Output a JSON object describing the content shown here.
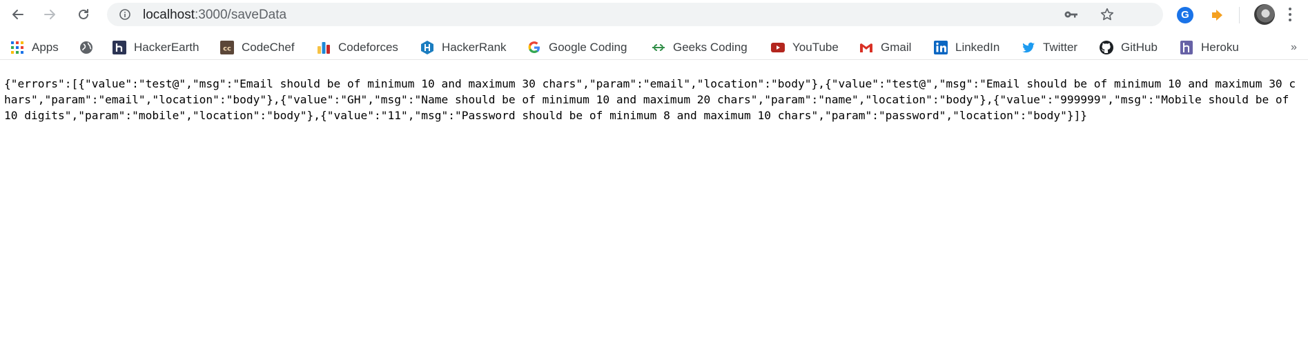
{
  "browser": {
    "url_host": "localhost",
    "url_path": ":3000/saveData"
  },
  "bookmarks": [
    {
      "label": "Apps",
      "icon": "apps-grid-icon"
    },
    {
      "label": "",
      "icon": "globe-icon"
    },
    {
      "label": "HackerEarth",
      "icon": "hackerearth-icon"
    },
    {
      "label": "CodeChef",
      "icon": "codechef-icon"
    },
    {
      "label": "Codeforces",
      "icon": "codeforces-icon"
    },
    {
      "label": "HackerRank",
      "icon": "hackerrank-icon"
    },
    {
      "label": "Google Coding",
      "icon": "google-icon"
    },
    {
      "label": "Geeks Coding",
      "icon": "geeksforgeeks-icon"
    },
    {
      "label": "YouTube",
      "icon": "youtube-icon"
    },
    {
      "label": "Gmail",
      "icon": "gmail-icon"
    },
    {
      "label": "LinkedIn",
      "icon": "linkedin-icon"
    },
    {
      "label": "Twitter",
      "icon": "twitter-icon"
    },
    {
      "label": "GitHub",
      "icon": "github-icon"
    },
    {
      "label": "Heroku",
      "icon": "heroku-icon"
    }
  ],
  "page": {
    "body_text": "{\"errors\":[{\"value\":\"test@\",\"msg\":\"Email should be of minimum 10 and maximum 30 chars\",\"param\":\"email\",\"location\":\"body\"},{\"value\":\"test@\",\"msg\":\"Email should be of minimum 10 and maximum 30 chars\",\"param\":\"email\",\"location\":\"body\"},{\"value\":\"GH\",\"msg\":\"Name should be of minimum 10 and maximum 20 chars\",\"param\":\"name\",\"location\":\"body\"},{\"value\":\"999999\",\"msg\":\"Mobile should be of 10 digits\",\"param\":\"mobile\",\"location\":\"body\"},{\"value\":\"11\",\"msg\":\"Password should be of minimum 8 and maximum 10 chars\",\"param\":\"password\",\"location\":\"body\"}]}"
  },
  "colors": {
    "omnibox_bg": "#f1f3f4",
    "text": "#000000",
    "chrome_icon": "#5f6368"
  }
}
